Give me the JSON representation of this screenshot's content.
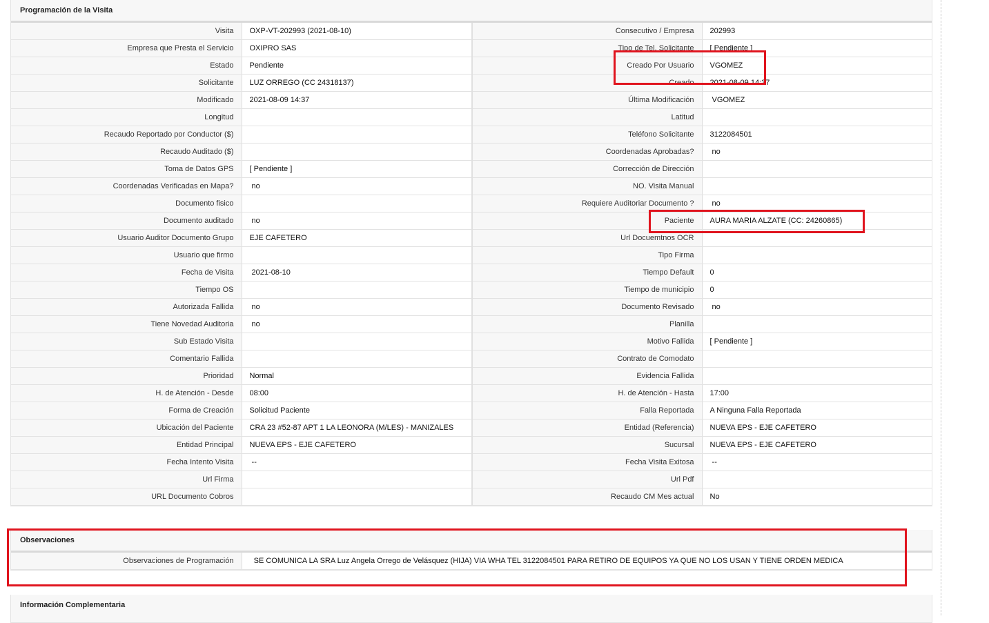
{
  "programacion": {
    "title": "Programación de la Visita",
    "rows": [
      [
        {
          "label": "Visita",
          "value": "OXP-VT-202993 (2021-08-10)"
        },
        {
          "label": "Consecutivo / Empresa",
          "value": "202993"
        }
      ],
      [
        {
          "label": "Empresa que Presta el Servicio",
          "value": "OXIPRO SAS"
        },
        {
          "label": "Tipo de Tel. Solicitante",
          "value": "[ Pendiente ]"
        }
      ],
      [
        {
          "label": "Estado",
          "value": "Pendiente"
        },
        {
          "label": "Creado Por Usuario",
          "value": "VGOMEZ"
        }
      ],
      [
        {
          "label": "Solicitante",
          "value": "LUZ ORREGO (CC 24318137)"
        },
        {
          "label": "Creado",
          "value": "2021-08-09 14:37"
        }
      ],
      [
        {
          "label": "Modificado",
          "value": "2021-08-09 14:37"
        },
        {
          "label": "Última Modificación",
          "value": " VGOMEZ"
        }
      ],
      [
        {
          "label": "Longitud",
          "value": ""
        },
        {
          "label": "Latitud",
          "value": ""
        }
      ],
      [
        {
          "label": "Recaudo Reportado por Conductor ($)",
          "value": ""
        },
        {
          "label": "Teléfono Solicitante",
          "value": "3122084501"
        }
      ],
      [
        {
          "label": "Recaudo Auditado ($)",
          "value": ""
        },
        {
          "label": "Coordenadas Aprobadas?",
          "value": " no"
        }
      ],
      [
        {
          "label": "Toma de Datos GPS",
          "value": "[ Pendiente ]"
        },
        {
          "label": "Corrección de Dirección",
          "value": ""
        }
      ],
      [
        {
          "label": "Coordenadas Verificadas en Mapa?",
          "value": " no"
        },
        {
          "label": "NO. Visita Manual",
          "value": ""
        }
      ],
      [
        {
          "label": "Documento fisico",
          "value": ""
        },
        {
          "label": "Requiere Auditoriar Documento ?",
          "value": " no"
        }
      ],
      [
        {
          "label": "Documento auditado",
          "value": " no"
        },
        {
          "label": "Paciente",
          "value": "AURA MARIA ALZATE (CC: 24260865)"
        }
      ],
      [
        {
          "label": "Usuario Auditor Documento Grupo",
          "value": "EJE CAFETERO"
        },
        {
          "label": "Url Docuemtnos OCR",
          "value": ""
        }
      ],
      [
        {
          "label": "Usuario que firmo",
          "value": ""
        },
        {
          "label": "Tipo Firma",
          "value": ""
        }
      ],
      [
        {
          "label": "Fecha de Visita",
          "value": " 2021-08-10"
        },
        {
          "label": "Tiempo Default",
          "value": "0"
        }
      ],
      [
        {
          "label": "Tiempo OS",
          "value": ""
        },
        {
          "label": "Tiempo de municipio",
          "value": "0"
        }
      ],
      [
        {
          "label": "Autorizada Fallida",
          "value": " no"
        },
        {
          "label": "Documento Revisado",
          "value": " no"
        }
      ],
      [
        {
          "label": "Tiene Novedad Auditoria",
          "value": " no"
        },
        {
          "label": "Planilla",
          "value": ""
        }
      ],
      [
        {
          "label": "Sub Estado Visita",
          "value": ""
        },
        {
          "label": "Motivo Fallida",
          "value": "[ Pendiente ]"
        }
      ],
      [
        {
          "label": "Comentario Fallida",
          "value": ""
        },
        {
          "label": "Contrato de Comodato",
          "value": ""
        }
      ],
      [
        {
          "label": "Prioridad",
          "value": "Normal"
        },
        {
          "label": "Evidencia Fallida",
          "value": ""
        }
      ],
      [
        {
          "label": "H. de Atención - Desde",
          "value": "08:00"
        },
        {
          "label": "H. de Atención - Hasta",
          "value": "17:00"
        }
      ],
      [
        {
          "label": "Forma de Creación",
          "value": "Solicitud Paciente"
        },
        {
          "label": "Falla Reportada",
          "value": "A Ninguna Falla Reportada"
        }
      ],
      [
        {
          "label": "Ubicación del Paciente",
          "value": "CRA 23 #52-87 APT 1 LA LEONORA (M/LES) - MANIZALES"
        },
        {
          "label": "Entidad (Referencia)",
          "value": "NUEVA EPS - EJE CAFETERO"
        }
      ],
      [
        {
          "label": "Entidad Principal",
          "value": "NUEVA EPS - EJE CAFETERO"
        },
        {
          "label": "Sucursal",
          "value": "NUEVA EPS - EJE CAFETERO"
        }
      ],
      [
        {
          "label": "Fecha Intento Visita",
          "value": " --"
        },
        {
          "label": "Fecha Visita Exitosa",
          "value": " --"
        }
      ],
      [
        {
          "label": "Url Firma",
          "value": ""
        },
        {
          "label": "Url Pdf",
          "value": ""
        }
      ],
      [
        {
          "label": "URL Documento Cobros",
          "value": ""
        },
        {
          "label": "Recaudo CM Mes actual",
          "value": "No"
        }
      ]
    ]
  },
  "observaciones": {
    "title": "Observaciones",
    "label": "Observaciones de Programación",
    "value": "  SE COMUNICA LA SRA Luz Angela Orrego de Velásquez (HIJA) VIA WHA TEL 3122084501 PARA RETIRO DE EQUIPOS YA QUE NO LOS USAN Y TIENE ORDEN MEDICA"
  },
  "complementaria": {
    "title": "Información Complementaria"
  },
  "colors": {
    "highlight": "#e0141e"
  }
}
